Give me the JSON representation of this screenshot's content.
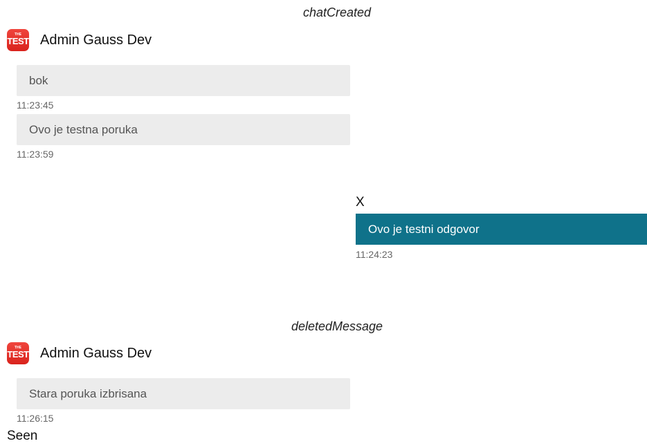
{
  "conversation": [
    {
      "event": "chatCreated",
      "sender": {
        "name": "Admin Gauss Dev",
        "avatar_small_text": "THE",
        "avatar_big_text": "TEST",
        "avatar_color": "#e5302a"
      },
      "messages": [
        {
          "text": "bok",
          "time": "11:23:45"
        },
        {
          "text": "Ovo je testna poruka",
          "time": "11:23:59"
        }
      ],
      "reply": {
        "sender_label": "X",
        "text": "Ovo je testni odgovor",
        "time": "11:24:23",
        "bubble_color": "#0f728a"
      }
    },
    {
      "event": "deletedMessage",
      "sender": {
        "name": "Admin Gauss Dev",
        "avatar_small_text": "THE",
        "avatar_big_text": "TEST",
        "avatar_color": "#e5302a"
      },
      "messages": [
        {
          "text": "Stara poruka izbrisana",
          "time": "11:26:15"
        }
      ],
      "status": "Seen"
    }
  ]
}
